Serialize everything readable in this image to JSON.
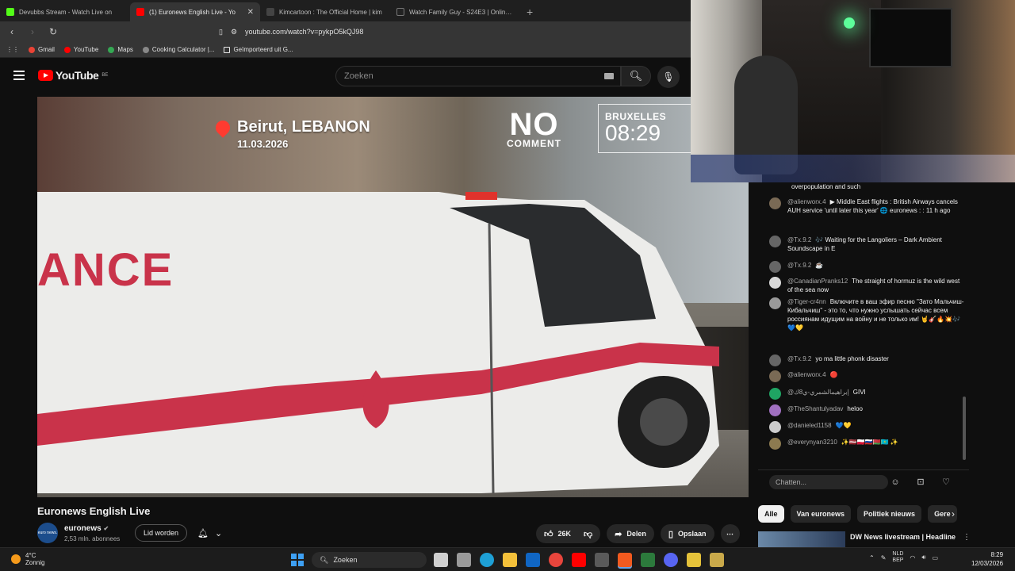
{
  "browser": {
    "tabs": [
      {
        "title": "Devubbs Stream - Watch Live on",
        "color": "#53fc18",
        "active": false
      },
      {
        "title": "(1) Euronews English Live - Yo",
        "color": "#ff0000",
        "active": true
      },
      {
        "title": "Kimcartoon : The Official Home | kim",
        "color": "#444444",
        "active": false
      },
      {
        "title": "Watch Family Guy - S24E3 | Online H",
        "color": "#222222",
        "active": false
      }
    ],
    "url": "youtube.com/watch?v=pykpO5kQJ98",
    "bookmarks": [
      {
        "label": "Gmail",
        "color": "#ea4335"
      },
      {
        "label": "YouTube",
        "color": "#ff0000"
      },
      {
        "label": "Maps",
        "color": "#34a853"
      },
      {
        "label": "Cooking Calculator |...",
        "color": "#888888"
      },
      {
        "label": "Geïmporteerd uit G...",
        "color": "#e8e8e8"
      }
    ]
  },
  "youtube": {
    "logo_text": "YouTube",
    "logo_region": "BE",
    "search_placeholder": "Zoeken"
  },
  "video": {
    "location": "Beirut, LEBANON",
    "date": "11.03.2026",
    "brand_top": "NO",
    "brand_bottom": "COMMENT",
    "clock_place": "BRUXELLES",
    "clock_time": "08:29",
    "ambulance_text": "ANCE"
  },
  "meta": {
    "title": "Euronews English Live",
    "channel": "euronews",
    "channel_avatar": "euro news.",
    "subscribers": "2,53 mln. abonnees",
    "join_label": "Lid worden",
    "likes": "26K",
    "share_label": "Delen",
    "save_label": "Opslaan"
  },
  "chat": {
    "top_line": "overpopulation and such",
    "messages": [
      {
        "author": "@alienworx.4",
        "text": "▶ Middle East flights : British Airways cancels AUH service 'until later this year' 🌐 euronews : : 11 h ago",
        "color": "#7a6a55"
      },
      {
        "author": "@Tx.9.2",
        "text": "🎶 Waiting for the Langoliers – Dark Ambient Soundscape in E",
        "color": "#666666"
      },
      {
        "author": "@Tx.9.2",
        "text": "☕",
        "color": "#666666"
      },
      {
        "author": "@CanadianPranks12",
        "text": "The straight of hormuz is the wild west of the sea now",
        "color": "#d8d8d8"
      },
      {
        "author": "@Tiger-cr4nn",
        "text": "Включите в ваш эфир песню \"Зато Мальчиш-Кибальчиш\" - это то, что нужно услышать сейчас всем россиянам идущим на войну и не только им! 🤘🎸🔥💥🎶 💙💛",
        "color": "#9a9a9a"
      },
      {
        "author": "@Tx.9.2",
        "text": "yo ma little phonk disaster",
        "color": "#666666"
      },
      {
        "author": "@alienworx.4",
        "text": "🔴",
        "color": "#7a6a55"
      },
      {
        "author": "@إبراهيمالشمري-ي8ك",
        "text": "GIVI",
        "color": "#1fa463"
      },
      {
        "author": "@TheShantulyadav",
        "text": "heloo",
        "color": "#a070c0"
      },
      {
        "author": "@danieled1158",
        "text": "💙💛",
        "color": "#cccccc"
      },
      {
        "author": "@everynyan3210",
        "text": "✨🇱🇻🇵🇱🇷🇺🇧🇾🇰🇿 ✨",
        "color": "#8c7a50"
      }
    ],
    "input_placeholder": "Chatten..."
  },
  "chips": [
    "Alle",
    "Van euronews",
    "Politiek nieuws",
    "Gere"
  ],
  "recommendation": {
    "title": "DW News livestream | Headline"
  },
  "taskbar": {
    "temperature": "4°C",
    "condition": "Zonnig",
    "search_label": "Zoeken",
    "lang_top": "NLD",
    "lang_bottom": "BEP",
    "time": "8:29",
    "date": "12/03/2026"
  }
}
